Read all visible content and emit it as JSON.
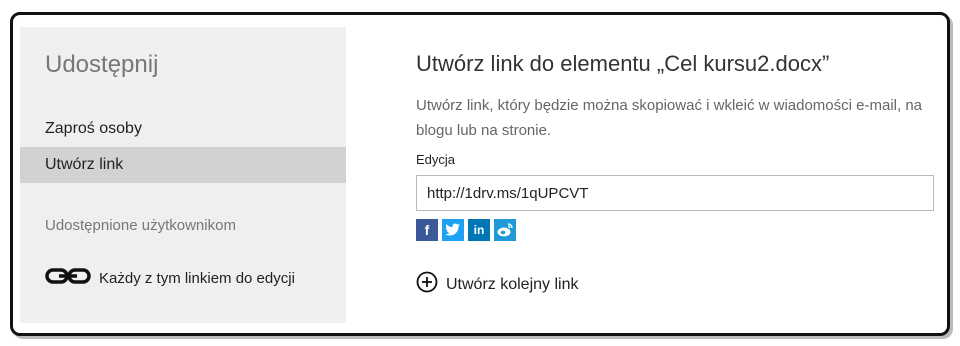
{
  "sidebar": {
    "title": "Udostępnij",
    "items": [
      {
        "label": "Zaproś osoby"
      },
      {
        "label": "Utwórz link"
      }
    ],
    "section_title": "Udostępnione użytkownikom",
    "permission": {
      "label": "Każdy z tym linkiem do edycji",
      "icon": "link-icon"
    }
  },
  "main": {
    "title": "Utwórz link do elementu „Cel kursu2.docx”",
    "description": "Utwórz link, który będzie można skopiować i wkleić w wiadomości e-mail, na blogu lub na stronie.",
    "edit_label": "Edycja",
    "link_value": "http://1drv.ms/1qUPCVT",
    "social": [
      {
        "icon": "facebook-icon",
        "glyph": "f",
        "color": "#3b5998"
      },
      {
        "icon": "twitter-icon",
        "glyph": "t",
        "color": "#1da1f2"
      },
      {
        "icon": "linkedin-icon",
        "glyph": "in",
        "color": "#0077b5"
      },
      {
        "icon": "weibo-icon",
        "glyph": "w",
        "color": "#1f9ad6"
      }
    ],
    "new_link_label": "Utwórz kolejny link",
    "new_link_icon": "plus-circle-icon"
  }
}
